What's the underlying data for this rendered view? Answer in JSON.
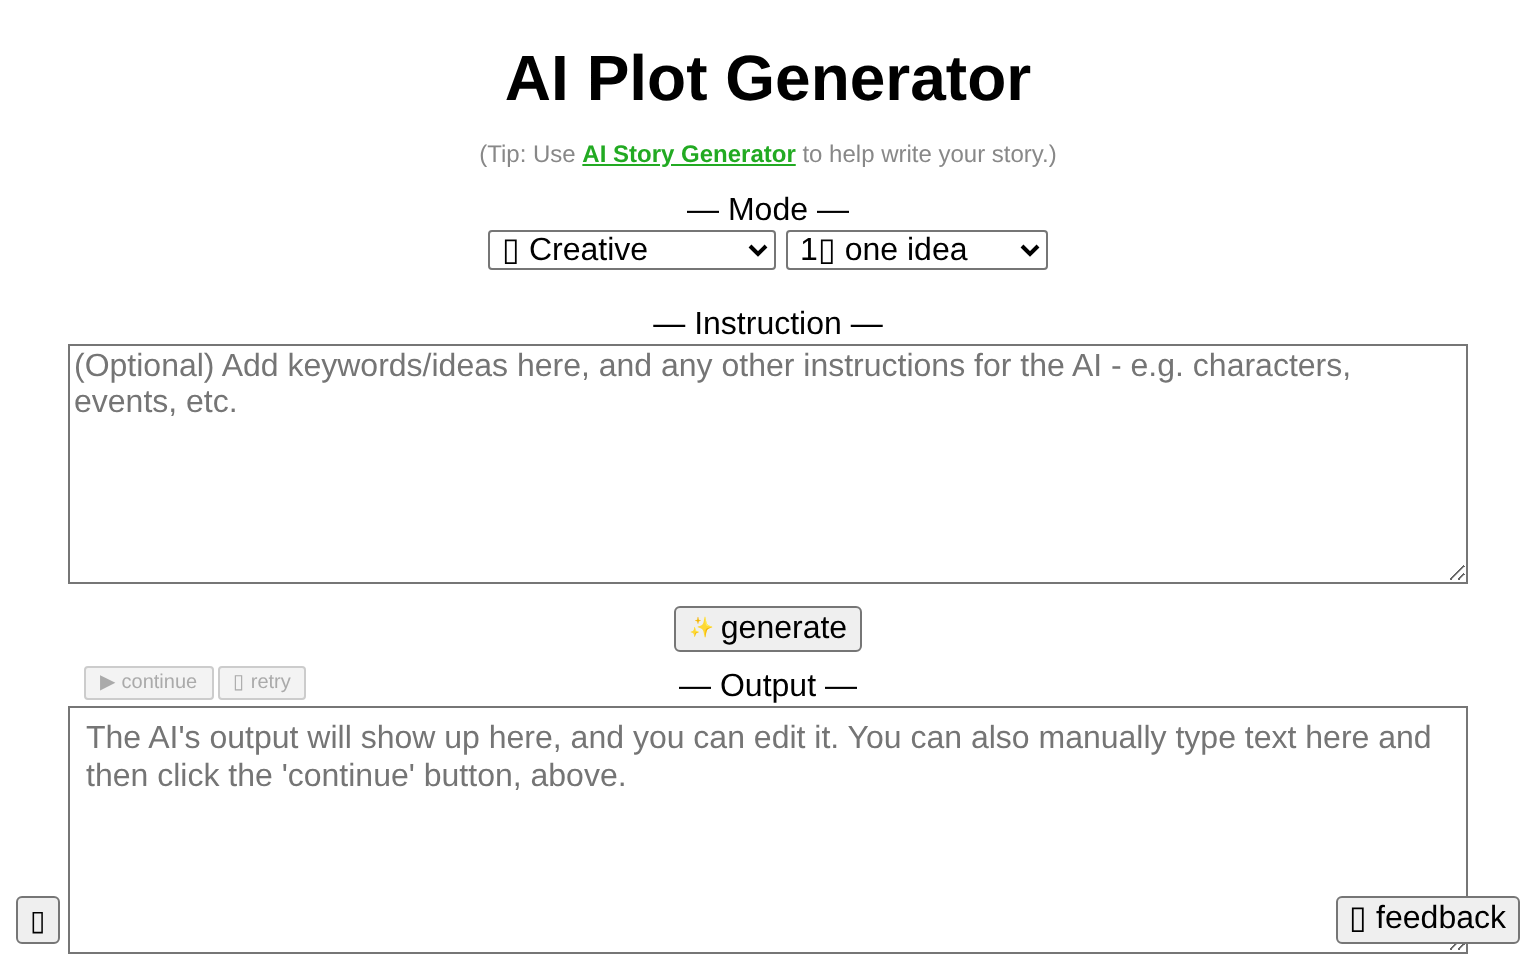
{
  "title": "AI Plot Generator",
  "tip": {
    "before": "(Tip: Use ",
    "link": "AI Story Generator",
    "after": " to help write your story.)"
  },
  "mode": {
    "label": "— Mode —",
    "style_select": "▯ Creative",
    "count_select": "1▯ one idea"
  },
  "instruction": {
    "label": "— Instruction —",
    "placeholder": "(Optional) Add keywords/ideas here, and any other instructions for the AI - e.g. characters, events, etc."
  },
  "generate_button": {
    "icon": "✨",
    "label": "generate"
  },
  "output": {
    "label": "— Output —",
    "placeholder": "The AI's output will show up here, and you can edit it. You can also manually type text here and then click the 'continue' button, above.",
    "actions": [
      {
        "label": "▶ continue",
        "disabled": true
      },
      {
        "label": "▯ retry",
        "disabled": true
      }
    ]
  },
  "corner_button": "▯",
  "feedback_button": "▯ feedback"
}
